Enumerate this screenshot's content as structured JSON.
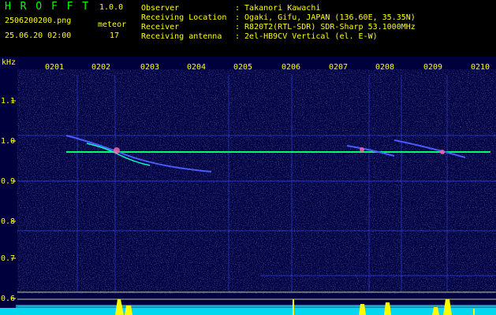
{
  "header": {
    "app_name": "H R O F F T",
    "version": "1.0.0",
    "filename": "2506200200.png",
    "datetime": "25.06.20 02:00",
    "meteor_label": "meteor",
    "meteor_count": "17",
    "info": [
      {
        "label": "Observer",
        "value": ": Takanori Kawachi"
      },
      {
        "label": "Receiving Location",
        "value": ": Ogaki, Gifu, JAPAN (136.60E, 35.35N)"
      },
      {
        "label": "Receiver",
        "value": ": R820T2(RTL-SDR) SDR-Sharp 53.1000MHz"
      },
      {
        "label": "Receiving antenna",
        "value": ": 2el-HB9CV Vertical (el. E-W)"
      }
    ]
  },
  "spectrogram": {
    "y_unit": "kHz",
    "time_labels": [
      "0201",
      "0202",
      "0203",
      "0204",
      "0205",
      "0206",
      "0207",
      "0208",
      "0209",
      "0210"
    ],
    "freq_labels": [
      "1.1",
      "1.0",
      "0.9",
      "0.8",
      "0.7",
      "0.6"
    ],
    "colors": {
      "background": "#00003c",
      "carrier": "#00ff66",
      "grid_tick": "#ffff00",
      "meter_fill": "#00e5ff",
      "meter_peak": "#ffff00"
    }
  }
}
